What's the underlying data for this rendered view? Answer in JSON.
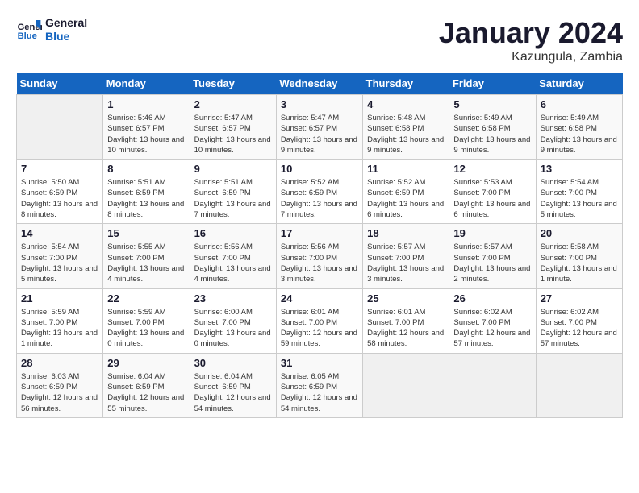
{
  "header": {
    "logo_line1": "General",
    "logo_line2": "Blue",
    "title": "January 2024",
    "subtitle": "Kazungula, Zambia"
  },
  "weekdays": [
    "Sunday",
    "Monday",
    "Tuesday",
    "Wednesday",
    "Thursday",
    "Friday",
    "Saturday"
  ],
  "weeks": [
    [
      {
        "day": "",
        "sunrise": "",
        "sunset": "",
        "daylight": ""
      },
      {
        "day": "1",
        "sunrise": "Sunrise: 5:46 AM",
        "sunset": "Sunset: 6:57 PM",
        "daylight": "Daylight: 13 hours and 10 minutes."
      },
      {
        "day": "2",
        "sunrise": "Sunrise: 5:47 AM",
        "sunset": "Sunset: 6:57 PM",
        "daylight": "Daylight: 13 hours and 10 minutes."
      },
      {
        "day": "3",
        "sunrise": "Sunrise: 5:47 AM",
        "sunset": "Sunset: 6:57 PM",
        "daylight": "Daylight: 13 hours and 9 minutes."
      },
      {
        "day": "4",
        "sunrise": "Sunrise: 5:48 AM",
        "sunset": "Sunset: 6:58 PM",
        "daylight": "Daylight: 13 hours and 9 minutes."
      },
      {
        "day": "5",
        "sunrise": "Sunrise: 5:49 AM",
        "sunset": "Sunset: 6:58 PM",
        "daylight": "Daylight: 13 hours and 9 minutes."
      },
      {
        "day": "6",
        "sunrise": "Sunrise: 5:49 AM",
        "sunset": "Sunset: 6:58 PM",
        "daylight": "Daylight: 13 hours and 9 minutes."
      }
    ],
    [
      {
        "day": "7",
        "sunrise": "Sunrise: 5:50 AM",
        "sunset": "Sunset: 6:59 PM",
        "daylight": "Daylight: 13 hours and 8 minutes."
      },
      {
        "day": "8",
        "sunrise": "Sunrise: 5:51 AM",
        "sunset": "Sunset: 6:59 PM",
        "daylight": "Daylight: 13 hours and 8 minutes."
      },
      {
        "day": "9",
        "sunrise": "Sunrise: 5:51 AM",
        "sunset": "Sunset: 6:59 PM",
        "daylight": "Daylight: 13 hours and 7 minutes."
      },
      {
        "day": "10",
        "sunrise": "Sunrise: 5:52 AM",
        "sunset": "Sunset: 6:59 PM",
        "daylight": "Daylight: 13 hours and 7 minutes."
      },
      {
        "day": "11",
        "sunrise": "Sunrise: 5:52 AM",
        "sunset": "Sunset: 6:59 PM",
        "daylight": "Daylight: 13 hours and 6 minutes."
      },
      {
        "day": "12",
        "sunrise": "Sunrise: 5:53 AM",
        "sunset": "Sunset: 7:00 PM",
        "daylight": "Daylight: 13 hours and 6 minutes."
      },
      {
        "day": "13",
        "sunrise": "Sunrise: 5:54 AM",
        "sunset": "Sunset: 7:00 PM",
        "daylight": "Daylight: 13 hours and 5 minutes."
      }
    ],
    [
      {
        "day": "14",
        "sunrise": "Sunrise: 5:54 AM",
        "sunset": "Sunset: 7:00 PM",
        "daylight": "Daylight: 13 hours and 5 minutes."
      },
      {
        "day": "15",
        "sunrise": "Sunrise: 5:55 AM",
        "sunset": "Sunset: 7:00 PM",
        "daylight": "Daylight: 13 hours and 4 minutes."
      },
      {
        "day": "16",
        "sunrise": "Sunrise: 5:56 AM",
        "sunset": "Sunset: 7:00 PM",
        "daylight": "Daylight: 13 hours and 4 minutes."
      },
      {
        "day": "17",
        "sunrise": "Sunrise: 5:56 AM",
        "sunset": "Sunset: 7:00 PM",
        "daylight": "Daylight: 13 hours and 3 minutes."
      },
      {
        "day": "18",
        "sunrise": "Sunrise: 5:57 AM",
        "sunset": "Sunset: 7:00 PM",
        "daylight": "Daylight: 13 hours and 3 minutes."
      },
      {
        "day": "19",
        "sunrise": "Sunrise: 5:57 AM",
        "sunset": "Sunset: 7:00 PM",
        "daylight": "Daylight: 13 hours and 2 minutes."
      },
      {
        "day": "20",
        "sunrise": "Sunrise: 5:58 AM",
        "sunset": "Sunset: 7:00 PM",
        "daylight": "Daylight: 13 hours and 1 minute."
      }
    ],
    [
      {
        "day": "21",
        "sunrise": "Sunrise: 5:59 AM",
        "sunset": "Sunset: 7:00 PM",
        "daylight": "Daylight: 13 hours and 1 minute."
      },
      {
        "day": "22",
        "sunrise": "Sunrise: 5:59 AM",
        "sunset": "Sunset: 7:00 PM",
        "daylight": "Daylight: 13 hours and 0 minutes."
      },
      {
        "day": "23",
        "sunrise": "Sunrise: 6:00 AM",
        "sunset": "Sunset: 7:00 PM",
        "daylight": "Daylight: 13 hours and 0 minutes."
      },
      {
        "day": "24",
        "sunrise": "Sunrise: 6:01 AM",
        "sunset": "Sunset: 7:00 PM",
        "daylight": "Daylight: 12 hours and 59 minutes."
      },
      {
        "day": "25",
        "sunrise": "Sunrise: 6:01 AM",
        "sunset": "Sunset: 7:00 PM",
        "daylight": "Daylight: 12 hours and 58 minutes."
      },
      {
        "day": "26",
        "sunrise": "Sunrise: 6:02 AM",
        "sunset": "Sunset: 7:00 PM",
        "daylight": "Daylight: 12 hours and 57 minutes."
      },
      {
        "day": "27",
        "sunrise": "Sunrise: 6:02 AM",
        "sunset": "Sunset: 7:00 PM",
        "daylight": "Daylight: 12 hours and 57 minutes."
      }
    ],
    [
      {
        "day": "28",
        "sunrise": "Sunrise: 6:03 AM",
        "sunset": "Sunset: 6:59 PM",
        "daylight": "Daylight: 12 hours and 56 minutes."
      },
      {
        "day": "29",
        "sunrise": "Sunrise: 6:04 AM",
        "sunset": "Sunset: 6:59 PM",
        "daylight": "Daylight: 12 hours and 55 minutes."
      },
      {
        "day": "30",
        "sunrise": "Sunrise: 6:04 AM",
        "sunset": "Sunset: 6:59 PM",
        "daylight": "Daylight: 12 hours and 54 minutes."
      },
      {
        "day": "31",
        "sunrise": "Sunrise: 6:05 AM",
        "sunset": "Sunset: 6:59 PM",
        "daylight": "Daylight: 12 hours and 54 minutes."
      },
      {
        "day": "",
        "sunrise": "",
        "sunset": "",
        "daylight": ""
      },
      {
        "day": "",
        "sunrise": "",
        "sunset": "",
        "daylight": ""
      },
      {
        "day": "",
        "sunrise": "",
        "sunset": "",
        "daylight": ""
      }
    ]
  ]
}
